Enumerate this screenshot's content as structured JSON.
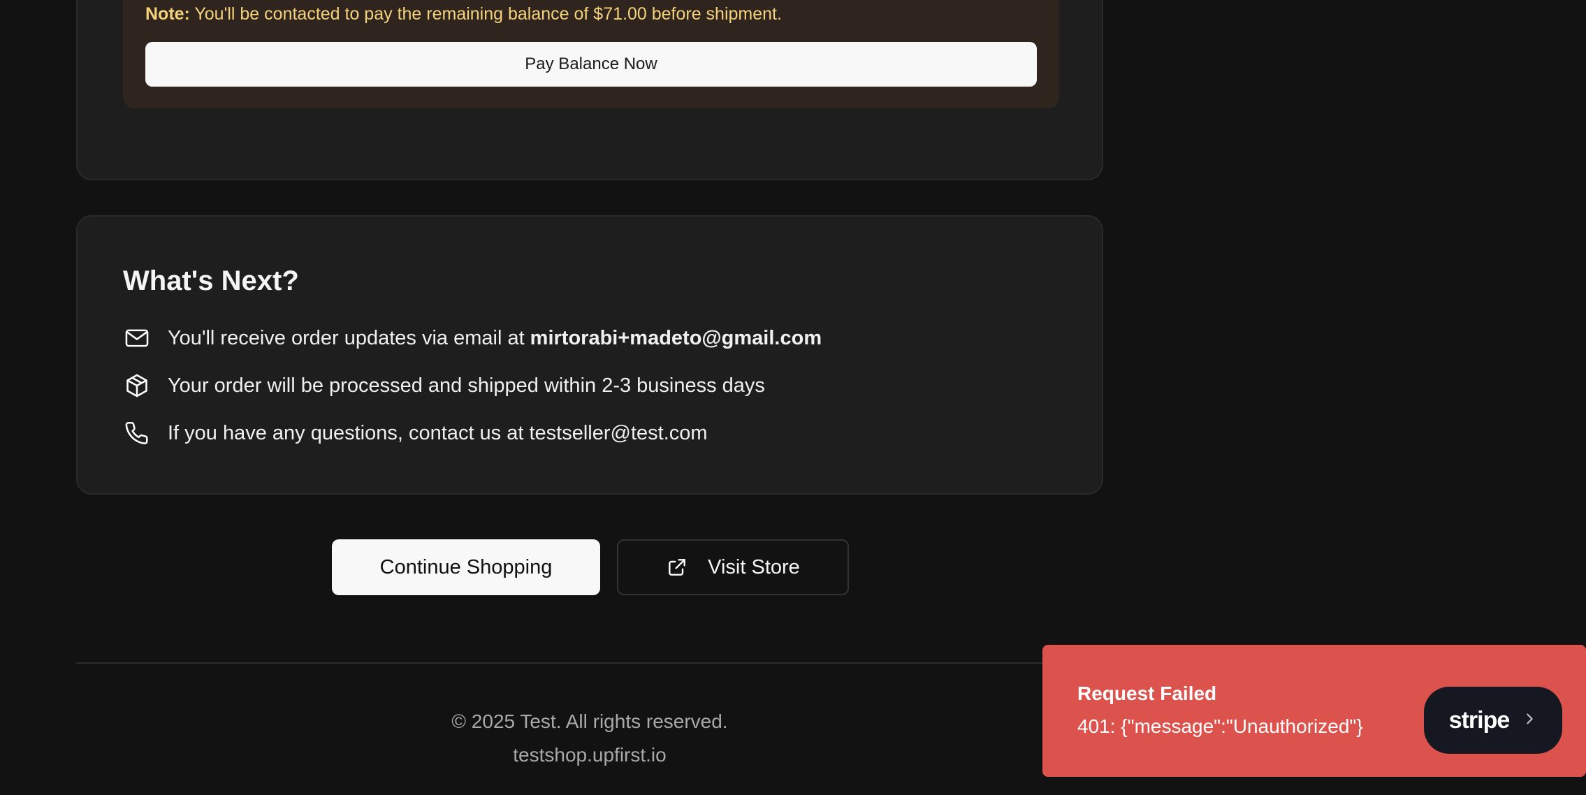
{
  "payment_note": {
    "label": "Note:",
    "text": "You'll be contacted to pay the remaining balance of $71.00 before shipment.",
    "pay_button": "Pay Balance Now"
  },
  "whats_next": {
    "title": "What's Next?",
    "items": [
      {
        "icon": "mail-icon",
        "text": "You'll receive order updates via email at",
        "email": "mirtorabi+madeto@gmail.com"
      },
      {
        "icon": "package-icon",
        "text": "Your order will be processed and shipped within 2-3 business days"
      },
      {
        "icon": "phone-icon",
        "text": "If you have any questions, contact us at testseller@test.com"
      }
    ]
  },
  "actions": {
    "continue_shopping": "Continue Shopping",
    "visit_store": "Visit Store",
    "visit_store_icon": "external-link-icon"
  },
  "footer": {
    "copyright": "© 2025 Test. All rights reserved.",
    "domain": "testshop.upfirst.io"
  },
  "toast": {
    "title": "Request Failed",
    "message": "401: {\"message\":\"Unauthorized\"}",
    "brand": "stripe",
    "brand_icon": "chevron-right-icon",
    "background": "#dc524c"
  },
  "colors": {
    "page_background": "#121212",
    "card_background": "#1e1e1e",
    "note_background": "#2f241e",
    "note_text": "#f3d27a",
    "button_light": "#f8f8f8"
  }
}
